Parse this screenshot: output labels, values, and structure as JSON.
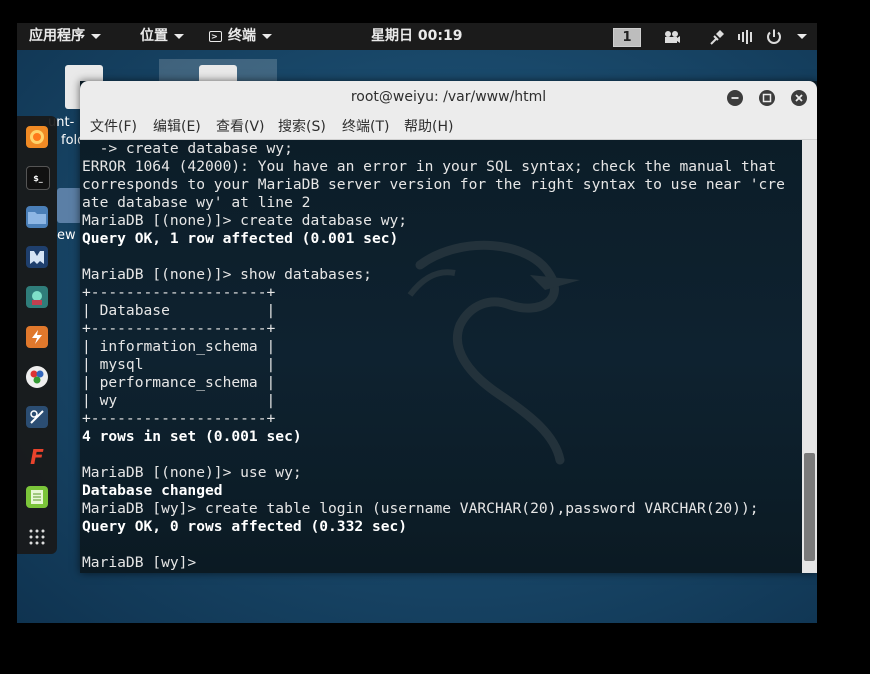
{
  "topbar": {
    "apps_label": "应用程序",
    "places_label": "位置",
    "terminal_label": "终端",
    "clock": "星期日 00:19",
    "workspace": "1"
  },
  "desktop": {
    "icon1_label_top": "unt-",
    "icon1_label_bottom": "folders",
    "icon2_label": "ew"
  },
  "dock": {
    "items": [
      "firefox",
      "terminal",
      "files",
      "metasploit",
      "armitage",
      "burpsuite",
      "maltego",
      "faraday",
      "freemind",
      "leafpad",
      "show-apps"
    ]
  },
  "window": {
    "title": "root@weiyu: /var/www/html",
    "menus": [
      "文件(F)",
      "编辑(E)",
      "查看(V)",
      "搜索(S)",
      "终端(T)",
      "帮助(H)"
    ]
  },
  "terminal": {
    "lines": [
      {
        "text": "  -> create database wy;",
        "bold": false
      },
      {
        "text": "ERROR 1064 (42000): You have an error in your SQL syntax; check the manual that",
        "bold": false
      },
      {
        "text": "corresponds to your MariaDB server version for the right syntax to use near 'cre",
        "bold": false
      },
      {
        "text": "ate database wy' at line 2",
        "bold": false
      },
      {
        "text": "MariaDB [(none)]> create database wy;",
        "bold": false
      },
      {
        "text": "Query OK, 1 row affected (0.001 sec)",
        "bold": true
      },
      {
        "text": "",
        "bold": false
      },
      {
        "text": "MariaDB [(none)]> show databases;",
        "bold": false
      },
      {
        "text": "+--------------------+",
        "bold": false
      },
      {
        "text": "| Database           |",
        "bold": false
      },
      {
        "text": "+--------------------+",
        "bold": false
      },
      {
        "text": "| information_schema |",
        "bold": false
      },
      {
        "text": "| mysql              |",
        "bold": false
      },
      {
        "text": "| performance_schema |",
        "bold": false
      },
      {
        "text": "| wy                 |",
        "bold": false
      },
      {
        "text": "+--------------------+",
        "bold": false
      },
      {
        "text": "4 rows in set (0.001 sec)",
        "bold": true
      },
      {
        "text": "",
        "bold": false
      },
      {
        "text": "MariaDB [(none)]> use wy;",
        "bold": false
      },
      {
        "text": "Database changed",
        "bold": true
      },
      {
        "text": "MariaDB [wy]> create table login (username VARCHAR(20),password VARCHAR(20));",
        "bold": false
      },
      {
        "text": "Query OK, 0 rows affected (0.332 sec)",
        "bold": true
      },
      {
        "text": "",
        "bold": false
      },
      {
        "text": "MariaDB [wy]> ",
        "bold": false
      }
    ]
  },
  "colors": {
    "topbar": "#1b1b1b",
    "terminal_bg": "#0c1d28",
    "titlebar": "#ececec"
  }
}
